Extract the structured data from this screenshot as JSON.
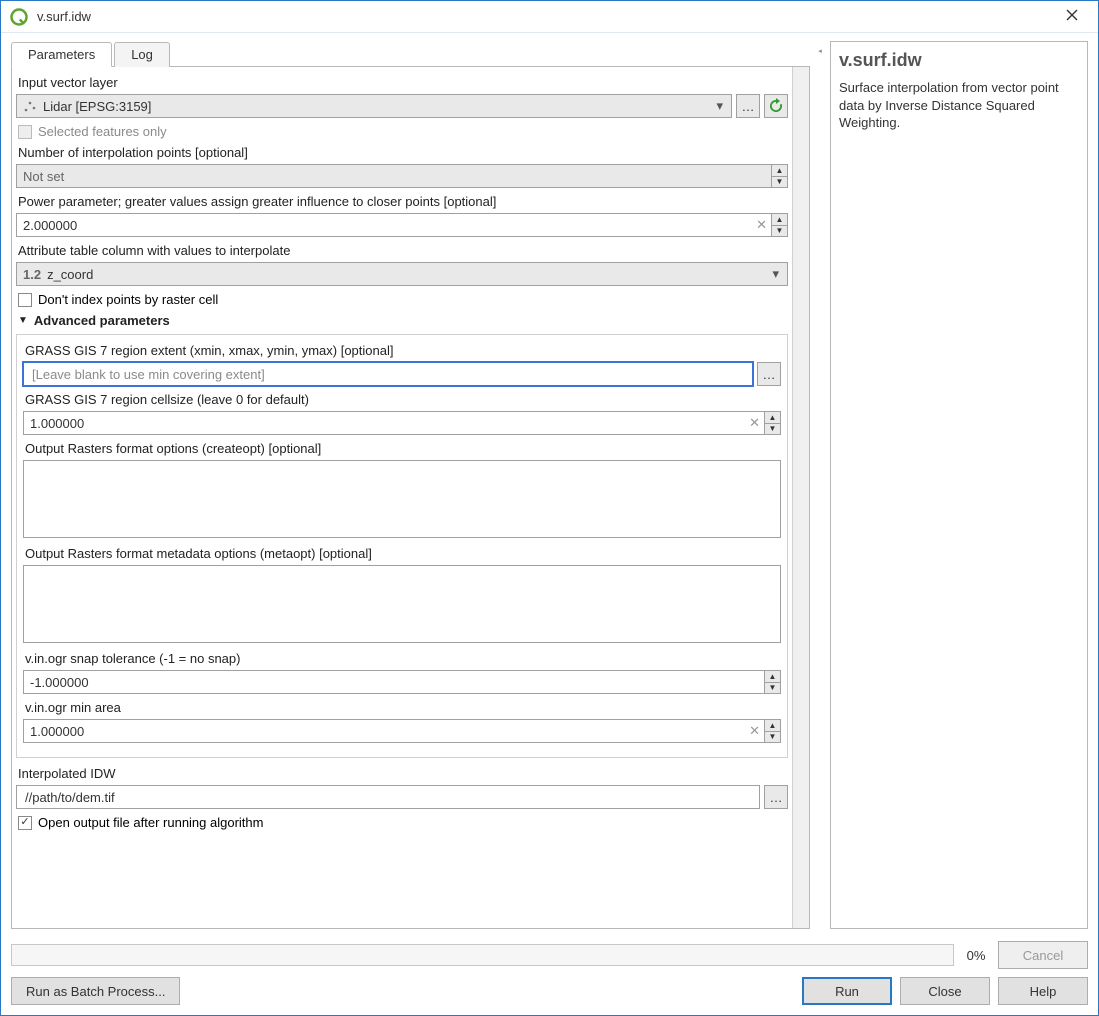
{
  "window": {
    "title": "v.surf.idw"
  },
  "tabs": {
    "parameters": "Parameters",
    "log": "Log"
  },
  "params": {
    "input_layer_label": "Input vector layer",
    "input_layer_value": "Lidar [EPSG:3159]",
    "selected_only": "Selected features only",
    "npoints_label": "Number of interpolation points [optional]",
    "npoints_value": "Not set",
    "power_label": "Power parameter; greater values assign greater influence to closer points [optional]",
    "power_value": "2.000000",
    "attr_label": "Attribute table column with values to interpolate",
    "attr_prefix": "1.2",
    "attr_value": "z_coord",
    "noindex": "Don't index points by raster cell",
    "adv_header": "Advanced parameters",
    "adv": {
      "extent_label": "GRASS GIS 7 region extent (xmin, xmax, ymin, ymax) [optional]",
      "extent_placeholder": "[Leave blank to use min covering extent]",
      "cellsize_label": "GRASS GIS 7 region cellsize (leave 0 for default)",
      "cellsize_value": "1.000000",
      "createopt_label": "Output Rasters format options (createopt) [optional]",
      "metaopt_label": "Output Rasters format metadata options (metaopt) [optional]",
      "snap_label": "v.in.ogr snap tolerance (-1 = no snap)",
      "snap_value": "-1.000000",
      "minarea_label": "v.in.ogr min area",
      "minarea_value": "1.000000"
    },
    "output_label": "Interpolated IDW",
    "output_value": "//path/to/dem.tif",
    "open_output": "Open output file after running algorithm"
  },
  "help": {
    "title": "v.surf.idw",
    "desc": "Surface interpolation from vector point data by Inverse Distance Squared Weighting."
  },
  "footer": {
    "percent": "0%",
    "cancel": "Cancel",
    "batch": "Run as Batch Process...",
    "run": "Run",
    "close": "Close",
    "helpbtn": "Help"
  }
}
